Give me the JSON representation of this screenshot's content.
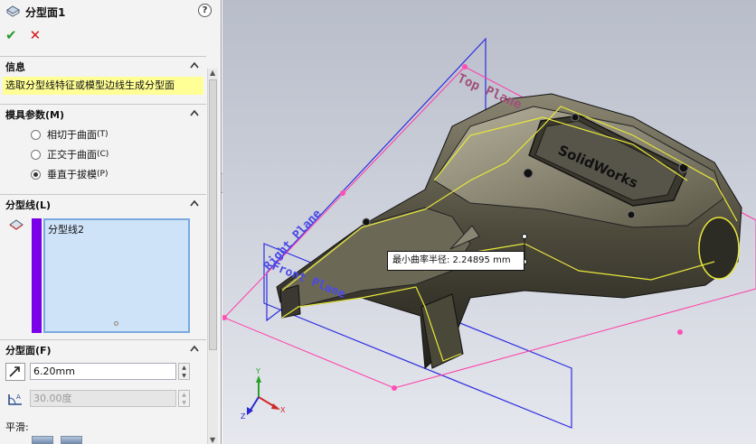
{
  "panel": {
    "title": "分型面1",
    "help_icon": "?",
    "ok_icon": "✔",
    "cancel_icon": "✕"
  },
  "info": {
    "header": "信息",
    "message": "选取分型线特征或模型边线生成分型面"
  },
  "mold_params": {
    "header": "模具参数(M)",
    "options": [
      {
        "label": "相切于曲面",
        "shortcut": "(T)",
        "selected": false
      },
      {
        "label": "正交于曲面",
        "shortcut": "(C)",
        "selected": false
      },
      {
        "label": "垂直于拔模",
        "shortcut": "(P)",
        "selected": true
      }
    ]
  },
  "parting_line": {
    "header": "分型线(L)",
    "items": [
      "分型线2"
    ],
    "highlight_color": "#7a00ea"
  },
  "parting_surface": {
    "header": "分型面(F)",
    "distance": "6.20mm",
    "angle": "30.00度",
    "smoothing_label": "平滑:"
  },
  "viewport": {
    "tooltip": "最小曲率半径: 2.24895 mm",
    "planes": [
      "Top Plane",
      "Right Plane",
      "Front Plane"
    ],
    "logo_text": "SolidWorks",
    "triad_axes": [
      "Y",
      "X",
      "Z"
    ],
    "plane_color": "#2e2ee0",
    "bound_color": "#ff3ca8",
    "parting_color": "#e8e83a"
  }
}
